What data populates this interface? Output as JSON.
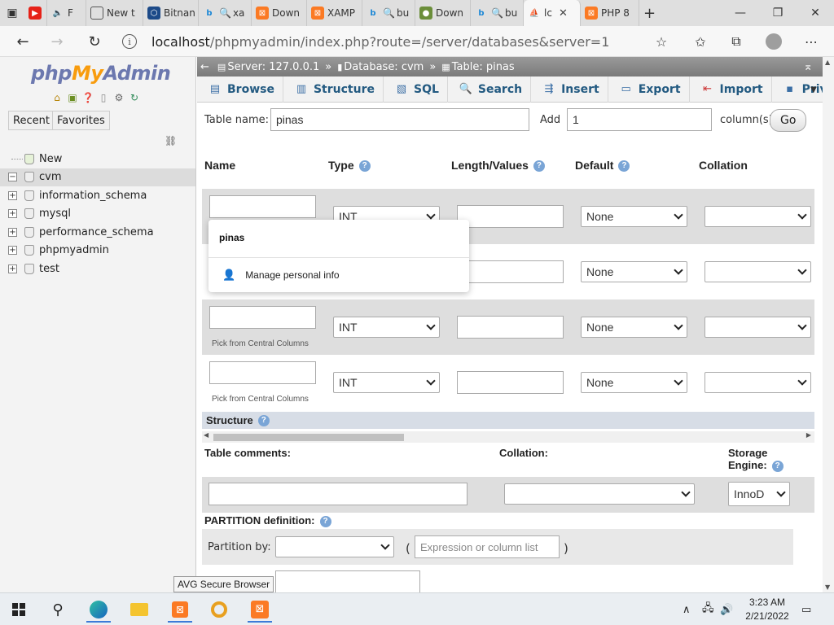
{
  "browser": {
    "tabs": [
      {
        "label": "",
        "icon": "media-icon",
        "color": "#e62117"
      },
      {
        "label": "F",
        "icon": "speaker-icon",
        "color": "#555555"
      },
      {
        "label": "New t",
        "icon": "new-tab-icon",
        "color": "#555555"
      },
      {
        "label": "Bitnan",
        "icon": "bitnami-icon",
        "color": "#1c4a88"
      },
      {
        "label": "xa",
        "icon": "bing-search-icon",
        "color": "#1b87d6"
      },
      {
        "label": "Down",
        "icon": "xampp-icon",
        "color": "#fb7a24"
      },
      {
        "label": "XAMP",
        "icon": "xampp-icon",
        "color": "#fb7a24"
      },
      {
        "label": "bu",
        "icon": "bing-search-icon",
        "color": "#1b87d6"
      },
      {
        "label": "Down",
        "icon": "download-icon",
        "color": "#6b8e3a"
      },
      {
        "label": "bu",
        "icon": "bing-search-icon",
        "color": "#1b87d6"
      },
      {
        "label": "lc",
        "icon": "phpmyadmin-icon",
        "color": "#f89c0e",
        "active": true
      },
      {
        "label": "PHP 8",
        "icon": "xampp-icon",
        "color": "#fb7a24"
      }
    ],
    "url_host": "localhost",
    "url_path": "/phpmyadmin/index.php?route=/server/databases&server=1"
  },
  "sidebar": {
    "logo_php": "php",
    "logo_my": "My",
    "logo_admin": "Admin",
    "recent_label": "Recent",
    "favorites_label": "Favorites",
    "tree": [
      {
        "label": "New",
        "expander": ""
      },
      {
        "label": "cvm",
        "expander": "−",
        "selected": true
      },
      {
        "label": "information_schema",
        "expander": "+"
      },
      {
        "label": "mysql",
        "expander": "+"
      },
      {
        "label": "performance_schema",
        "expander": "+"
      },
      {
        "label": "phpmyadmin",
        "expander": "+"
      },
      {
        "label": "test",
        "expander": "+"
      }
    ]
  },
  "breadcrumb": {
    "server": "Server: 127.0.0.1",
    "database": "Database: cvm",
    "table": "Table: pinas",
    "sep": "»"
  },
  "menu": {
    "browse": "Browse",
    "structure": "Structure",
    "sql": "SQL",
    "search": "Search",
    "insert": "Insert",
    "export": "Export",
    "import": "Import",
    "privileges": "Privileges"
  },
  "form": {
    "table_name_label": "Table name:",
    "table_name_value": "pinas",
    "add_label": "Add",
    "add_value": "1",
    "columns_label": "column(s)",
    "go_label": "Go"
  },
  "columns": {
    "name": "Name",
    "type": "Type",
    "length": "Length/Values",
    "default": "Default",
    "collation": "Collation"
  },
  "rows": [
    {
      "type": "INT",
      "default": "None",
      "pick": ""
    },
    {
      "type": "",
      "default": "None",
      "pick": ""
    },
    {
      "type": "INT",
      "default": "None",
      "pick": "Pick from Central Columns"
    },
    {
      "type": "INT",
      "default": "None",
      "pick": "Pick from Central Columns"
    }
  ],
  "structure_section": "Structure",
  "table_comments_label": "Table comments:",
  "collation_label": "Collation:",
  "storage_engine_label_1": "Storage",
  "storage_engine_label_2": "Engine:",
  "storage_engine_value": "InnoD",
  "partition_label": "PARTITION definition:",
  "partition_by_label": "Partition by:",
  "expression_placeholder": "Expression or column list",
  "paren_open": "(",
  "paren_close": ")",
  "autocomplete": {
    "suggestion": "pinas",
    "manage": "Manage personal info"
  },
  "tooltip": "AVG Secure Browser",
  "taskbar": {
    "time": "3:23 AM",
    "date": "2/21/2022"
  }
}
